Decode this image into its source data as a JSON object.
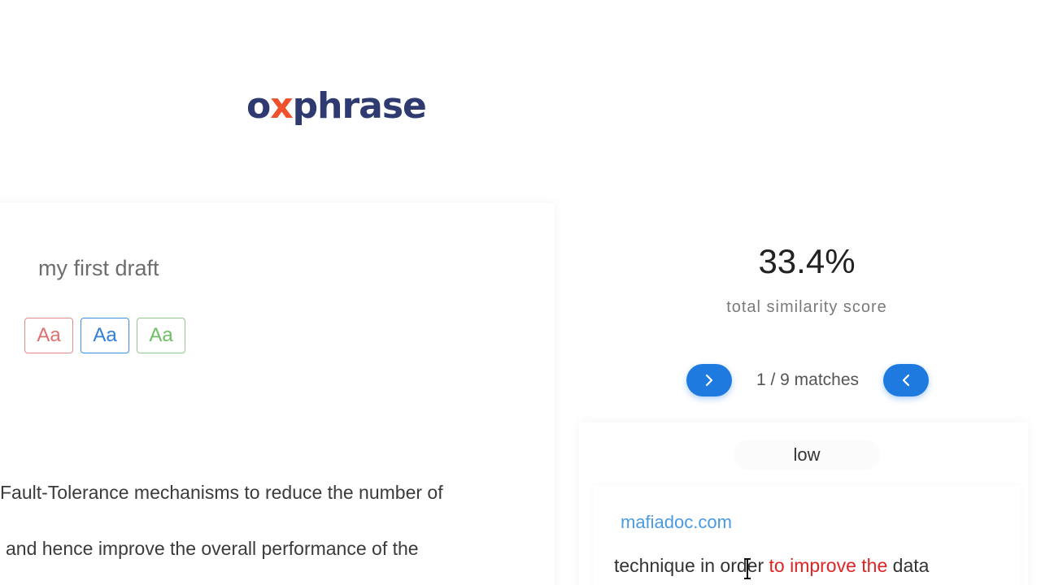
{
  "logo": {
    "o": "o",
    "x": "x",
    "rest": "phrase"
  },
  "left": {
    "draft_title": "my first draft",
    "font_buttons": [
      "Aa",
      "Aa",
      "Aa"
    ],
    "lines": [
      "Fault-Tolerance mechanisms to reduce the number of",
      "and hence improve the overall performance of the"
    ]
  },
  "right": {
    "score": "33.4%",
    "score_label": "total similarity score",
    "matches_label": "1 / 9 matches",
    "level": "low",
    "source": "mafiadoc.com",
    "match_text": {
      "before": "technique in order ",
      "highlight": "to improve the",
      "after": " data"
    }
  },
  "colors": {
    "accent": "#1f7ae0",
    "highlight": "#e02424",
    "logo_navy": "#2e3a70",
    "logo_orange": "#f0502c"
  },
  "icons": {
    "next": "chevron-right-icon",
    "prev": "chevron-left-icon",
    "cursor": "text-cursor-icon"
  }
}
